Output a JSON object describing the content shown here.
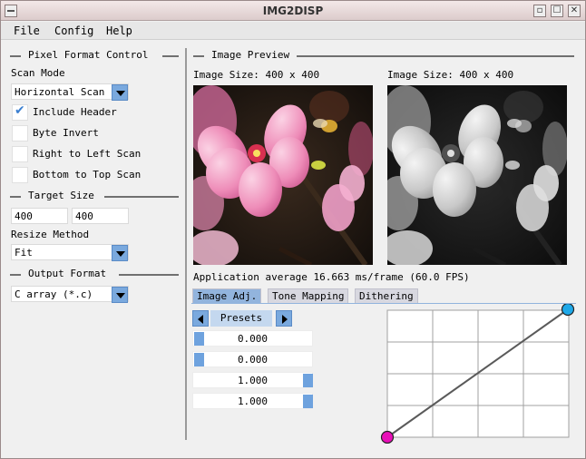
{
  "window": {
    "title": "IMG2DISP"
  },
  "menubar": {
    "items": [
      "File",
      "Config",
      "Help"
    ]
  },
  "left": {
    "pixel_format": {
      "heading": "Pixel Format Control",
      "scan_mode_label": "Scan Mode",
      "scan_mode_value": "Horizontal Scan",
      "options": [
        {
          "label": "Include Header",
          "checked": true
        },
        {
          "label": "Byte Invert",
          "checked": false
        },
        {
          "label": "Right to Left Scan",
          "checked": false
        },
        {
          "label": "Bottom to Top Scan",
          "checked": false
        }
      ]
    },
    "target_size": {
      "heading": "Target Size",
      "width": "400",
      "height": "400",
      "resize_label": "Resize Method",
      "resize_value": "Fit"
    },
    "output_format": {
      "heading": "Output Format",
      "value": "C array (*.c)"
    }
  },
  "preview": {
    "heading": "Image Preview",
    "source_size": "Image Size: 400 x 400",
    "output_size": "Image Size: 400 x 400",
    "stats": "Application average 16.663 ms/frame (60.0 FPS)"
  },
  "tabs": [
    "Image Adj.",
    "Tone Mapping",
    "Dithering"
  ],
  "active_tab": 0,
  "adjust": {
    "presets_label": "Presets",
    "sliders": [
      {
        "value": "0.000",
        "fraction": 0.0
      },
      {
        "value": "0.000",
        "fraction": 0.0
      },
      {
        "value": "1.000",
        "fraction": 1.0
      },
      {
        "value": "1.000",
        "fraction": 1.0
      }
    ]
  },
  "curve": {
    "start": [
      0,
      0
    ],
    "end": [
      1,
      1
    ],
    "start_color": "#e810b8",
    "end_color": "#1ea8e8"
  },
  "colors": {
    "accent": "#7aa9de",
    "tab_active": "#92b4dd"
  }
}
